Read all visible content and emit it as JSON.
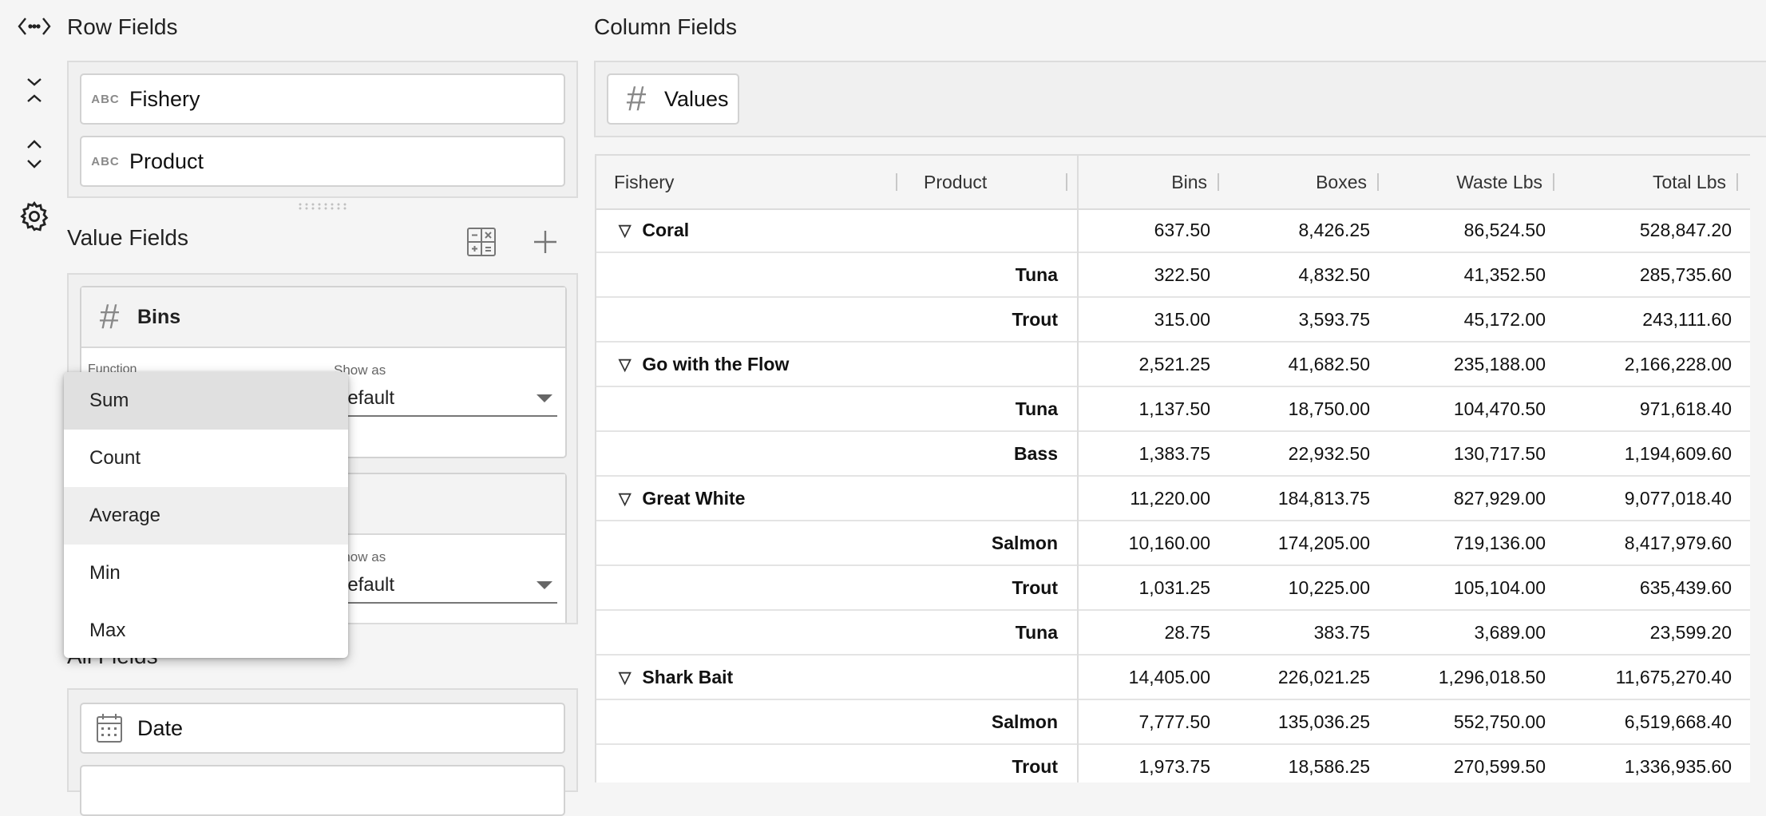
{
  "panel": {
    "row_fields_title": "Row Fields",
    "value_fields_title": "Value Fields",
    "column_fields_title": "Column Fields",
    "all_fields_title": "All Fields",
    "row_fields": [
      {
        "type": "ABC",
        "name": "Fishery"
      },
      {
        "type": "ABC",
        "name": "Product"
      }
    ],
    "column_fields": [
      {
        "type": "#",
        "name": "Values"
      }
    ],
    "value_fields": [
      {
        "name": "Bins",
        "function_label": "Function",
        "show_as_label": "Show as",
        "show_as_value": "Default"
      },
      {
        "show_as_label": "Show as",
        "show_as_value": "Default"
      }
    ],
    "all_fields": [
      {
        "name": "Date"
      }
    ]
  },
  "function_menu": {
    "items": [
      "Sum",
      "Count",
      "Average",
      "Min",
      "Max"
    ],
    "selected": "Sum"
  },
  "grid": {
    "headers": [
      "Fishery",
      "Product",
      "Bins",
      "Boxes",
      "Waste Lbs",
      "Total Lbs"
    ],
    "rows": [
      {
        "fishery": "Coral",
        "product": "",
        "bins": "637.50",
        "boxes": "8,426.25",
        "waste": "86,524.50",
        "total": "528,847.20",
        "group": true
      },
      {
        "fishery": "",
        "product": "Tuna",
        "bins": "322.50",
        "boxes": "4,832.50",
        "waste": "41,352.50",
        "total": "285,735.60"
      },
      {
        "fishery": "",
        "product": "Trout",
        "bins": "315.00",
        "boxes": "3,593.75",
        "waste": "45,172.00",
        "total": "243,111.60"
      },
      {
        "fishery": "Go with the Flow",
        "product": "",
        "bins": "2,521.25",
        "boxes": "41,682.50",
        "waste": "235,188.00",
        "total": "2,166,228.00",
        "group": true
      },
      {
        "fishery": "",
        "product": "Tuna",
        "bins": "1,137.50",
        "boxes": "18,750.00",
        "waste": "104,470.50",
        "total": "971,618.40"
      },
      {
        "fishery": "",
        "product": "Bass",
        "bins": "1,383.75",
        "boxes": "22,932.50",
        "waste": "130,717.50",
        "total": "1,194,609.60"
      },
      {
        "fishery": "Great White",
        "product": "",
        "bins": "11,220.00",
        "boxes": "184,813.75",
        "waste": "827,929.00",
        "total": "9,077,018.40",
        "group": true
      },
      {
        "fishery": "",
        "product": "Salmon",
        "bins": "10,160.00",
        "boxes": "174,205.00",
        "waste": "719,136.00",
        "total": "8,417,979.60"
      },
      {
        "fishery": "",
        "product": "Trout",
        "bins": "1,031.25",
        "boxes": "10,225.00",
        "waste": "105,104.00",
        "total": "635,439.60"
      },
      {
        "fishery": "",
        "product": "Tuna",
        "bins": "28.75",
        "boxes": "383.75",
        "waste": "3,689.00",
        "total": "23,599.20"
      },
      {
        "fishery": "Shark Bait",
        "product": "",
        "bins": "14,405.00",
        "boxes": "226,021.25",
        "waste": "1,296,018.50",
        "total": "11,675,270.40",
        "group": true
      },
      {
        "fishery": "",
        "product": "Salmon",
        "bins": "7,777.50",
        "boxes": "135,036.25",
        "waste": "552,750.00",
        "total": "6,519,668.40"
      },
      {
        "fishery": "",
        "product": "Trout",
        "bins": "1,973.75",
        "boxes": "18,586.25",
        "waste": "270,599.50",
        "total": "1,336,935.60"
      }
    ]
  }
}
